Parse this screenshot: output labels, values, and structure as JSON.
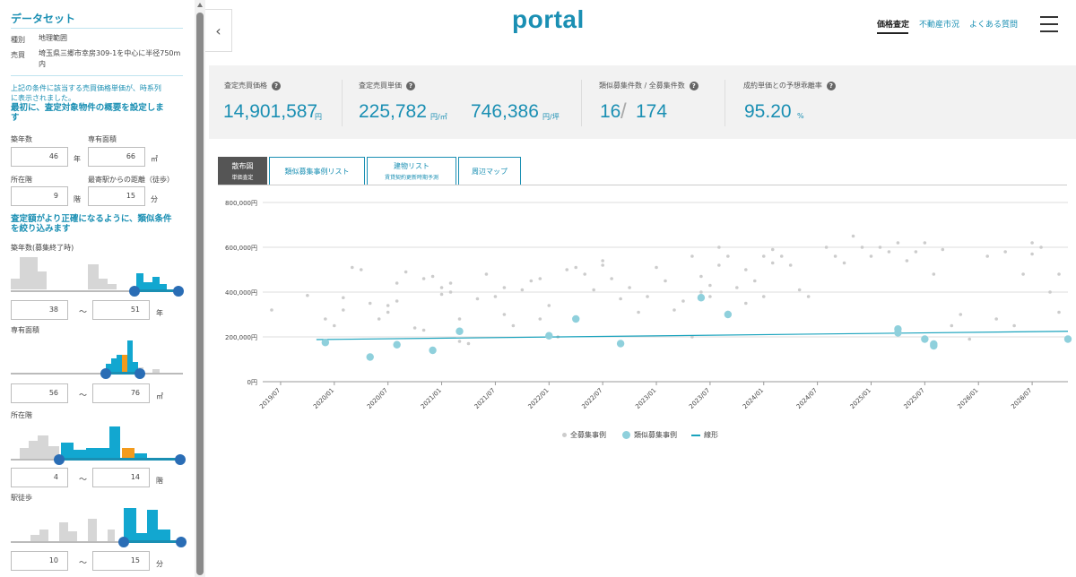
{
  "sidebar": {
    "title": "データセット",
    "kind_label": "種別",
    "kind_value": "地理範囲",
    "sale_label": "売買",
    "sale_value_line1": "埼玉県三郷市幸房309-1を中心に半径750m",
    "sale_value_line2": "内",
    "note_line1": "上記の条件に該当する売買価格単価が、時系列",
    "note_line2": "に表示されました。",
    "setup_heading_line1": "最初に、査定対象物件の概要を設定しま",
    "setup_heading_line2": "す",
    "age_label": "築年数",
    "age_value": "46",
    "age_unit": "年",
    "area_label": "専有面積",
    "area_value": "66",
    "area_unit": "㎡",
    "floor_label": "所在階",
    "floor_value": "9",
    "floor_unit": "階",
    "walk_label": "最寄駅からの距離（徒歩）",
    "walk_value": "15",
    "walk_unit": "分",
    "refine_heading_line1": "査定額がより正確になるように、類似条件",
    "refine_heading_line2": "を絞り込みます",
    "filters": [
      {
        "label": "築年数(募集終了時)",
        "min": "38",
        "max": "51",
        "unit": "年"
      },
      {
        "label": "専有面積",
        "min": "56",
        "max": "76",
        "unit": "㎡"
      },
      {
        "label": "所在階",
        "min": "4",
        "max": "14",
        "unit": "階"
      },
      {
        "label": "駅徒歩",
        "min": "10",
        "max": "15",
        "unit": "分"
      }
    ],
    "tilde": "〜"
  },
  "header": {
    "logo": "portal",
    "nav": [
      {
        "label": "価格査定",
        "active": true
      },
      {
        "label": "不動産市況",
        "active": false
      },
      {
        "label": "よくある質問",
        "active": false
      }
    ],
    "collapse_icon": "‹"
  },
  "stats": {
    "price_label": "査定売買価格",
    "price_value": "14,901,587",
    "price_unit": "円",
    "unit_label": "査定売買単価",
    "unit_m2_value": "225,782",
    "unit_m2_unit": "円/㎡",
    "unit_tsubo_value": "746,386",
    "unit_tsubo_unit": "円/坪",
    "count_label": "類似募集件数 / 全募集件数",
    "count_similar": "16",
    "count_slash": "/",
    "count_total": "174",
    "rate_label": "成約単価との予想乖離率",
    "rate_value": "95.20",
    "rate_unit": "%",
    "help_glyph": "?"
  },
  "tabs": [
    {
      "label": "散布図",
      "sub": "単価査定",
      "active": true
    },
    {
      "label": "類似募集事例リスト",
      "sub": "",
      "active": false
    },
    {
      "label": "建物リスト",
      "sub": "賃貸契約更新時期予測",
      "active": false
    },
    {
      "label": "周辺マップ",
      "sub": "",
      "active": false
    }
  ],
  "chart_data": {
    "type": "scatter",
    "y_tick_labels": [
      "0円",
      "200,000円",
      "400,000円",
      "600,000円",
      "800,000円"
    ],
    "y_ticks": [
      0,
      200000,
      400000,
      600000,
      800000
    ],
    "ylim": [
      0,
      800000
    ],
    "x_tick_labels": [
      "2019/07",
      "2020/01",
      "2020/07",
      "2021/01",
      "2021/07",
      "2022/01",
      "2022/07",
      "2023/01",
      "2023/07",
      "2024/01",
      "2024/07",
      "2025/01",
      "2025/07",
      "2026/01",
      "2026/07"
    ],
    "xlim": [
      "2019/05",
      "2026/11"
    ],
    "grid": "horizontal",
    "legend_position": "bottom",
    "colors": {
      "all": "#cccccc",
      "similar": "#8fd0dc",
      "line": "#1aa3bd"
    },
    "series": [
      {
        "name": "全募集事例",
        "points": [
          [
            "2019/06",
            320000
          ],
          [
            "2019/10",
            385000
          ],
          [
            "2019/12",
            280000
          ],
          [
            "2020/01",
            250000
          ],
          [
            "2020/02",
            320000
          ],
          [
            "2020/02",
            375000
          ],
          [
            "2020/03",
            510000
          ],
          [
            "2020/04",
            500000
          ],
          [
            "2020/05",
            350000
          ],
          [
            "2020/06",
            280000
          ],
          [
            "2020/07",
            310000
          ],
          [
            "2020/07",
            340000
          ],
          [
            "2020/08",
            360000
          ],
          [
            "2020/08",
            440000
          ],
          [
            "2020/09",
            490000
          ],
          [
            "2020/10",
            240000
          ],
          [
            "2020/11",
            230000
          ],
          [
            "2020/11",
            460000
          ],
          [
            "2020/12",
            470000
          ],
          [
            "2021/01",
            420000
          ],
          [
            "2021/01",
            390000
          ],
          [
            "2021/02",
            400000
          ],
          [
            "2021/02",
            440000
          ],
          [
            "2021/03",
            280000
          ],
          [
            "2021/03",
            180000
          ],
          [
            "2021/04",
            170000
          ],
          [
            "2021/05",
            370000
          ],
          [
            "2021/06",
            480000
          ],
          [
            "2021/07",
            380000
          ],
          [
            "2021/08",
            420000
          ],
          [
            "2021/08",
            300000
          ],
          [
            "2021/09",
            250000
          ],
          [
            "2021/10",
            410000
          ],
          [
            "2021/11",
            450000
          ],
          [
            "2021/12",
            460000
          ],
          [
            "2021/12",
            280000
          ],
          [
            "2022/01",
            340000
          ],
          [
            "2022/02",
            200000
          ],
          [
            "2022/03",
            500000
          ],
          [
            "2022/04",
            510000
          ],
          [
            "2022/05",
            480000
          ],
          [
            "2022/06",
            410000
          ],
          [
            "2022/07",
            540000
          ],
          [
            "2022/07",
            520000
          ],
          [
            "2022/08",
            460000
          ],
          [
            "2022/09",
            370000
          ],
          [
            "2022/10",
            420000
          ],
          [
            "2022/11",
            310000
          ],
          [
            "2022/12",
            380000
          ],
          [
            "2023/01",
            510000
          ],
          [
            "2023/02",
            450000
          ],
          [
            "2023/03",
            320000
          ],
          [
            "2023/04",
            360000
          ],
          [
            "2023/05",
            560000
          ],
          [
            "2023/05",
            200000
          ],
          [
            "2023/06",
            470000
          ],
          [
            "2023/06",
            400000
          ],
          [
            "2023/07",
            430000
          ],
          [
            "2023/07",
            380000
          ],
          [
            "2023/08",
            520000
          ],
          [
            "2023/08",
            600000
          ],
          [
            "2023/09",
            560000
          ],
          [
            "2023/09",
            310000
          ],
          [
            "2023/10",
            420000
          ],
          [
            "2023/11",
            500000
          ],
          [
            "2023/11",
            350000
          ],
          [
            "2023/12",
            450000
          ],
          [
            "2024/01",
            560000
          ],
          [
            "2024/01",
            380000
          ],
          [
            "2024/02",
            530000
          ],
          [
            "2024/02",
            590000
          ],
          [
            "2024/03",
            560000
          ],
          [
            "2024/04",
            520000
          ],
          [
            "2024/05",
            410000
          ],
          [
            "2024/06",
            380000
          ],
          [
            "2024/08",
            600000
          ],
          [
            "2024/09",
            560000
          ],
          [
            "2024/10",
            530000
          ],
          [
            "2024/11",
            650000
          ],
          [
            "2024/12",
            600000
          ],
          [
            "2025/01",
            560000
          ],
          [
            "2025/02",
            600000
          ],
          [
            "2025/03",
            580000
          ],
          [
            "2025/04",
            620000
          ],
          [
            "2025/05",
            540000
          ],
          [
            "2025/06",
            580000
          ],
          [
            "2025/07",
            620000
          ],
          [
            "2025/08",
            480000
          ],
          [
            "2025/09",
            590000
          ],
          [
            "2025/10",
            250000
          ],
          [
            "2025/11",
            300000
          ],
          [
            "2025/12",
            190000
          ],
          [
            "2026/02",
            560000
          ],
          [
            "2026/03",
            280000
          ],
          [
            "2026/04",
            580000
          ],
          [
            "2026/05",
            250000
          ],
          [
            "2026/06",
            480000
          ],
          [
            "2026/07",
            620000
          ],
          [
            "2026/07",
            570000
          ],
          [
            "2026/08",
            600000
          ],
          [
            "2026/09",
            400000
          ],
          [
            "2026/10",
            310000
          ],
          [
            "2026/10",
            480000
          ]
        ]
      },
      {
        "name": "類似募集事例",
        "points": [
          [
            "2019/12",
            175000
          ],
          [
            "2020/05",
            110000
          ],
          [
            "2020/08",
            165000
          ],
          [
            "2020/12",
            140000
          ],
          [
            "2021/03",
            225000
          ],
          [
            "2022/01",
            205000
          ],
          [
            "2022/04",
            280000
          ],
          [
            "2022/09",
            170000
          ],
          [
            "2023/06",
            375000
          ],
          [
            "2023/09",
            300000
          ],
          [
            "2025/04",
            235000
          ],
          [
            "2025/04",
            218000
          ],
          [
            "2025/07",
            190000
          ],
          [
            "2025/08",
            160000
          ],
          [
            "2025/08",
            168000
          ],
          [
            "2026/11",
            190000
          ]
        ]
      },
      {
        "name": "線形",
        "points": [
          [
            "2019/11",
            188000
          ],
          [
            "2026/11",
            225000
          ]
        ]
      }
    ]
  }
}
